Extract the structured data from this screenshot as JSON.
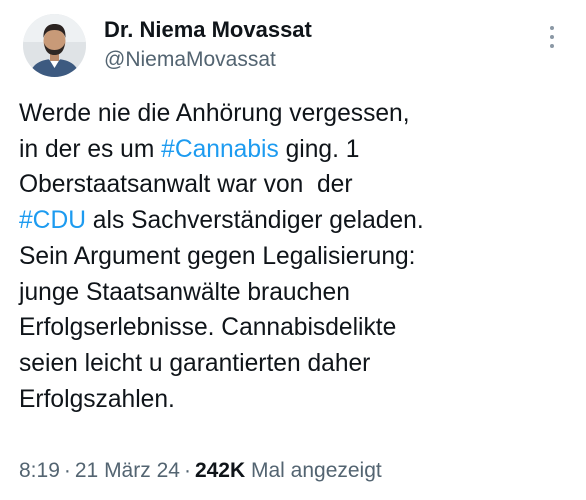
{
  "author": {
    "display_name": "Dr. Niema Movassat",
    "handle": "@NiemaMovassat"
  },
  "tweet": {
    "lines": [
      [
        {
          "text": "Werde nie die Anhörung vergessen,",
          "type": "text"
        }
      ],
      [
        {
          "text": "in der es um ",
          "type": "text"
        },
        {
          "text": "#Cannabis",
          "type": "hashtag"
        },
        {
          "text": " ging. 1",
          "type": "text"
        }
      ],
      [
        {
          "text": "Oberstaatsanwalt war von  der",
          "type": "text"
        }
      ],
      [
        {
          "text": "#CDU",
          "type": "hashtag"
        },
        {
          "text": " als Sachverständiger geladen.",
          "type": "text"
        }
      ],
      [
        {
          "text": "Sein Argument gegen Legalisierung:",
          "type": "text"
        }
      ],
      [
        {
          "text": "junge Staatsanwälte brauchen",
          "type": "text"
        }
      ],
      [
        {
          "text": "Erfolgserlebnisse. Cannabisdelikte",
          "type": "text"
        }
      ],
      [
        {
          "text": "seien leicht u garantierten daher",
          "type": "text"
        }
      ],
      [
        {
          "text": "Erfolgszahlen.",
          "type": "text"
        }
      ]
    ]
  },
  "meta": {
    "time": "8:19",
    "separator": "·",
    "date": "21 März 24",
    "views_count": "242K",
    "views_label": "Mal angezeigt"
  },
  "icons": {
    "more": "more-vertical-icon",
    "avatar": "profile-photo"
  },
  "colors": {
    "link": "#1d9bf0",
    "secondary": "#536471",
    "primary": "#0f1419"
  }
}
